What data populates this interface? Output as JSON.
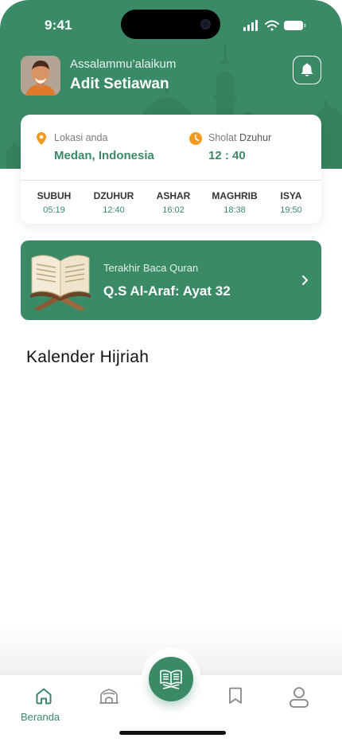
{
  "status_bar": {
    "time": "9:41"
  },
  "header": {
    "greeting": "Assalammu’alaikum",
    "user_name": "Adit Setiawan",
    "bell_icon": "bell-icon"
  },
  "prayer_card": {
    "location_label": "Lokasi anda",
    "location_value": "Medan, Indonesia",
    "sholat_label": "Sholat",
    "sholat_name": "Dzuhur",
    "sholat_time": "12 : 40",
    "times": [
      {
        "name": "SUBUH",
        "time": "05:19"
      },
      {
        "name": "DZUHUR",
        "time": "12:40"
      },
      {
        "name": "ASHAR",
        "time": "16:02"
      },
      {
        "name": "MAGHRIB",
        "time": "18:38"
      },
      {
        "name": "ISYA",
        "time": "19:50"
      }
    ]
  },
  "last_read": {
    "label": "Terakhir Baca Quran",
    "value": "Q.S Al-Araf: Ayat 32"
  },
  "calendar": {
    "title": "Kalender Hijriah"
  },
  "bottom_nav": {
    "items": [
      {
        "icon": "home-icon",
        "label": "Beranda",
        "active": true
      },
      {
        "icon": "mosque-icon",
        "label": "",
        "active": false
      },
      {
        "icon": "quran-icon",
        "label": "",
        "active": false
      },
      {
        "icon": "bookmark-icon",
        "label": "",
        "active": false
      },
      {
        "icon": "profile-icon",
        "label": "",
        "active": false
      }
    ]
  },
  "colors": {
    "primary": "#3b8a67",
    "accent": "#f29a1f",
    "text": "#111111"
  }
}
